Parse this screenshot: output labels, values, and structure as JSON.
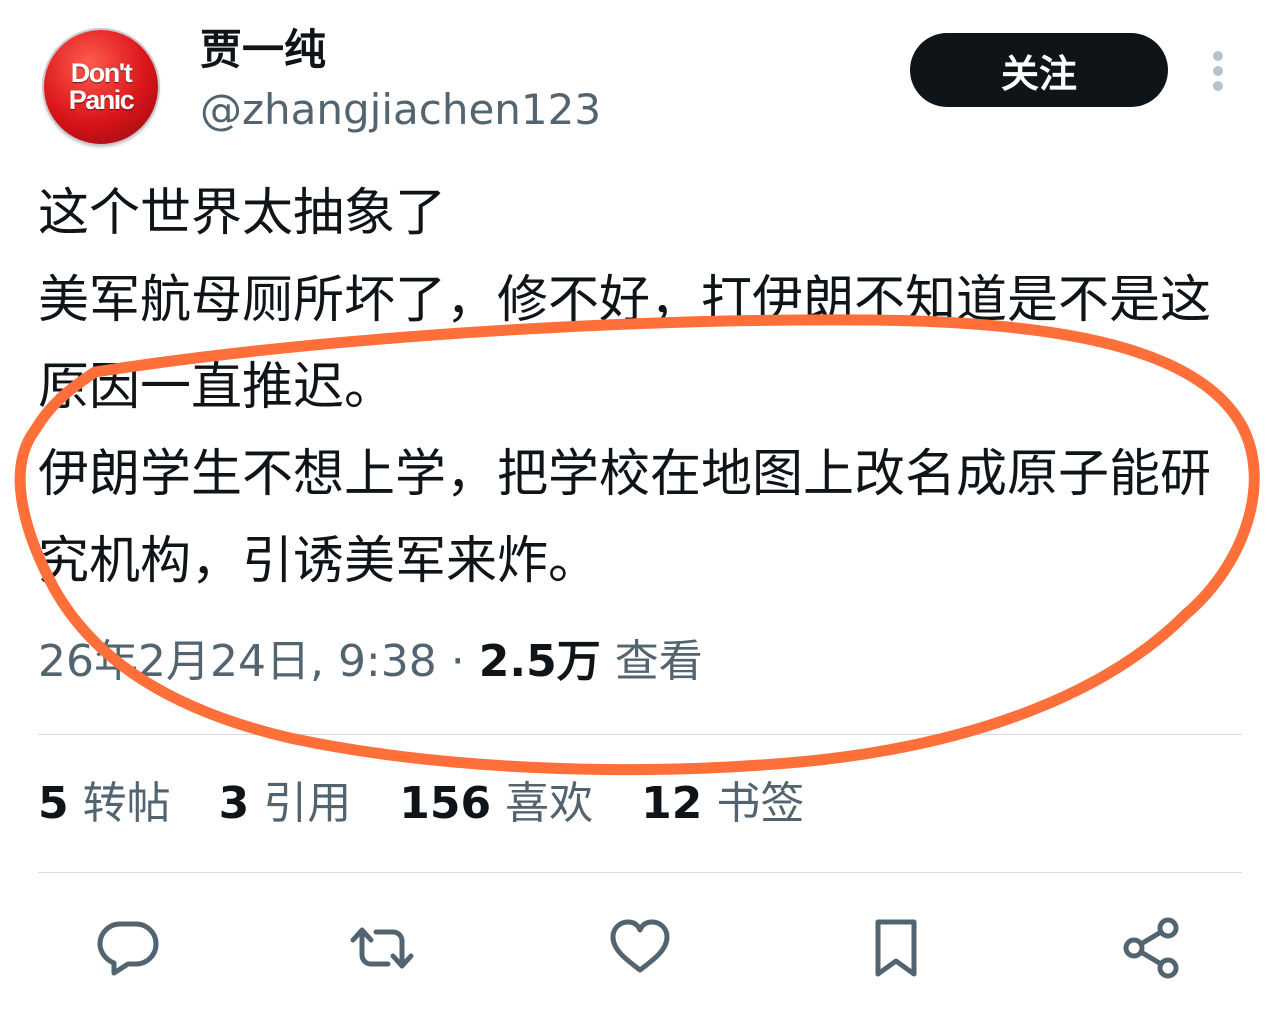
{
  "user": {
    "avatar_text": [
      "Don't",
      "Panic"
    ],
    "display_name": "贾一纯",
    "handle": "@zhangjiachen123"
  },
  "follow_button": {
    "label": "关注"
  },
  "tweet": {
    "text": "这个世界太抽象了\n美军航母厕所坏了，修不好，打伊朗不知道是不是这原因一直推迟。\n伊朗学生不想上学，把学校在地图上改名成原子能研究机构，引诱美军来炸。",
    "timestamp": "26年2月24日, 9:38",
    "separator": "·",
    "views_count": "2.5万",
    "views_label": "查看"
  },
  "stats": [
    {
      "count": "5",
      "label": "转帖"
    },
    {
      "count": "3",
      "label": "引用"
    },
    {
      "count": "156",
      "label": "喜欢"
    },
    {
      "count": "12",
      "label": "书签"
    }
  ],
  "actions": [
    "reply-icon",
    "retweet-icon",
    "like-icon",
    "bookmark-icon",
    "share-icon"
  ],
  "colors": {
    "text": "#0f1419",
    "secondary": "#536471",
    "button_bg": "#0f1419",
    "annotation": "#ff6f3a"
  }
}
